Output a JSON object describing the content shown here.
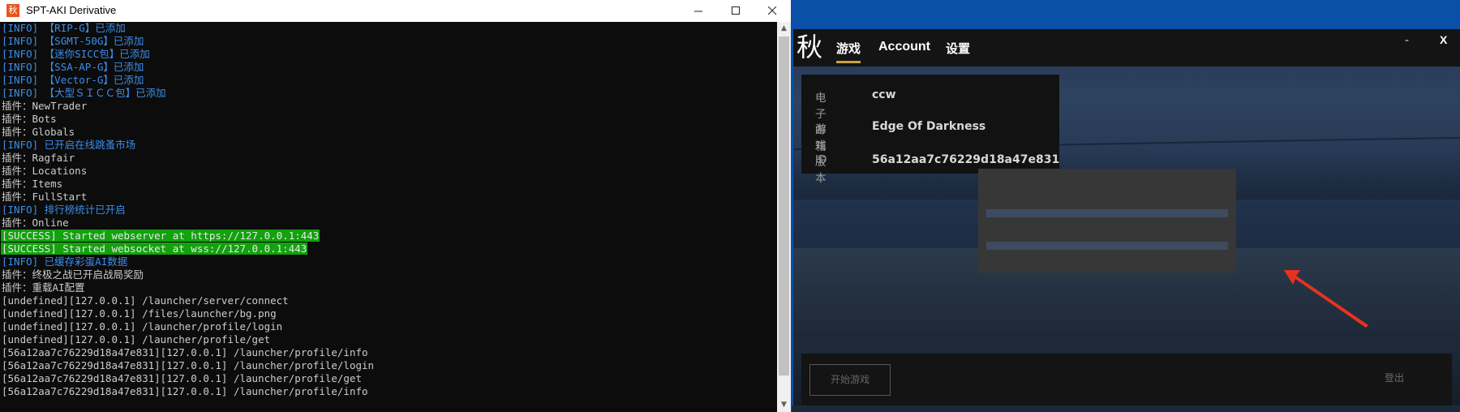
{
  "console": {
    "title": "SPT-AKI Derivative",
    "app_icon": "秋",
    "controls": {
      "minimize": "—",
      "maximize": "☐",
      "close": "✕"
    },
    "lines": [
      {
        "kind": "info",
        "text": "[INFO] 【RIP-G】已添加"
      },
      {
        "kind": "info",
        "text": "[INFO] 【SGMT-50G】已添加"
      },
      {
        "kind": "info",
        "text": "[INFO] 【迷你SICC包】已添加"
      },
      {
        "kind": "info",
        "text": "[INFO] 【SSA-AP-G】已添加"
      },
      {
        "kind": "info",
        "text": "[INFO] 【Vector-G】已添加"
      },
      {
        "kind": "info",
        "text": "[INFO] 【大型ＳＩＣＣ包】已添加"
      },
      {
        "kind": "plain",
        "text": "插件：NewTrader"
      },
      {
        "kind": "plain",
        "text": "插件：Bots"
      },
      {
        "kind": "plain",
        "text": "插件：Globals"
      },
      {
        "kind": "info",
        "text": "[INFO] 已开启在线跳蚤市场"
      },
      {
        "kind": "plain",
        "text": "插件：Ragfair"
      },
      {
        "kind": "plain",
        "text": "插件：Locations"
      },
      {
        "kind": "plain",
        "text": "插件：Items"
      },
      {
        "kind": "plain",
        "text": "插件：FullStart"
      },
      {
        "kind": "info",
        "text": "[INFO] 排行榜统计已开启"
      },
      {
        "kind": "plain",
        "text": "插件：Online"
      },
      {
        "kind": "success",
        "text": "[SUCCESS] Started webserver at https://127.0.0.1:443"
      },
      {
        "kind": "success",
        "text": "[SUCCESS] Started websocket at wss://127.0.0.1:443"
      },
      {
        "kind": "info",
        "text": "[INFO] 已缓存彩蛋AI数据"
      },
      {
        "kind": "plain",
        "text": "插件：终极之战已开启战局奖励"
      },
      {
        "kind": "plain",
        "text": "插件：重载AI配置"
      },
      {
        "kind": "plain",
        "text": "[undefined][127.0.0.1] /launcher/server/connect"
      },
      {
        "kind": "plain",
        "text": "[undefined][127.0.0.1] /files/launcher/bg.png"
      },
      {
        "kind": "plain",
        "text": "[undefined][127.0.0.1] /launcher/profile/login"
      },
      {
        "kind": "plain",
        "text": "[undefined][127.0.0.1] /launcher/profile/get"
      },
      {
        "kind": "plain",
        "text": "[56a12aa7c76229d18a47e831][127.0.0.1] /launcher/profile/info"
      },
      {
        "kind": "plain",
        "text": "[56a12aa7c76229d18a47e831][127.0.0.1] /launcher/profile/login"
      },
      {
        "kind": "plain",
        "text": "[56a12aa7c76229d18a47e831][127.0.0.1] /launcher/profile/get"
      },
      {
        "kind": "plain",
        "text": "[56a12aa7c76229d18a47e831][127.0.0.1] /launcher/profile/info"
      }
    ],
    "scroll": {
      "up": "▲",
      "down": "▼"
    }
  },
  "launcher": {
    "logo": "秋",
    "tabs": {
      "game": "游戏",
      "account": "Account",
      "settings": "设置"
    },
    "window": {
      "minimize": "-",
      "close": "X"
    },
    "profile": {
      "email_label": "电子邮箱",
      "email_value": "ccw",
      "edition_label": "游戏版本",
      "edition_value": "Edge Of Darkness",
      "id_label": "ID",
      "id_value": "56a12aa7c76229d18a47e831"
    },
    "footer": {
      "start_label": "开始游戏",
      "logout_label": "登出"
    }
  },
  "colors": {
    "info_text": "#3b8eea",
    "success_bg": "#13a10e",
    "tab_underline": "#c9a23a",
    "annotation_arrow": "#e8321e"
  },
  "icons": [
    "app-icon",
    "minimize-icon",
    "maximize-icon",
    "close-icon",
    "scroll-up-icon",
    "scroll-down-icon",
    "arrow-annotation-icon"
  ]
}
